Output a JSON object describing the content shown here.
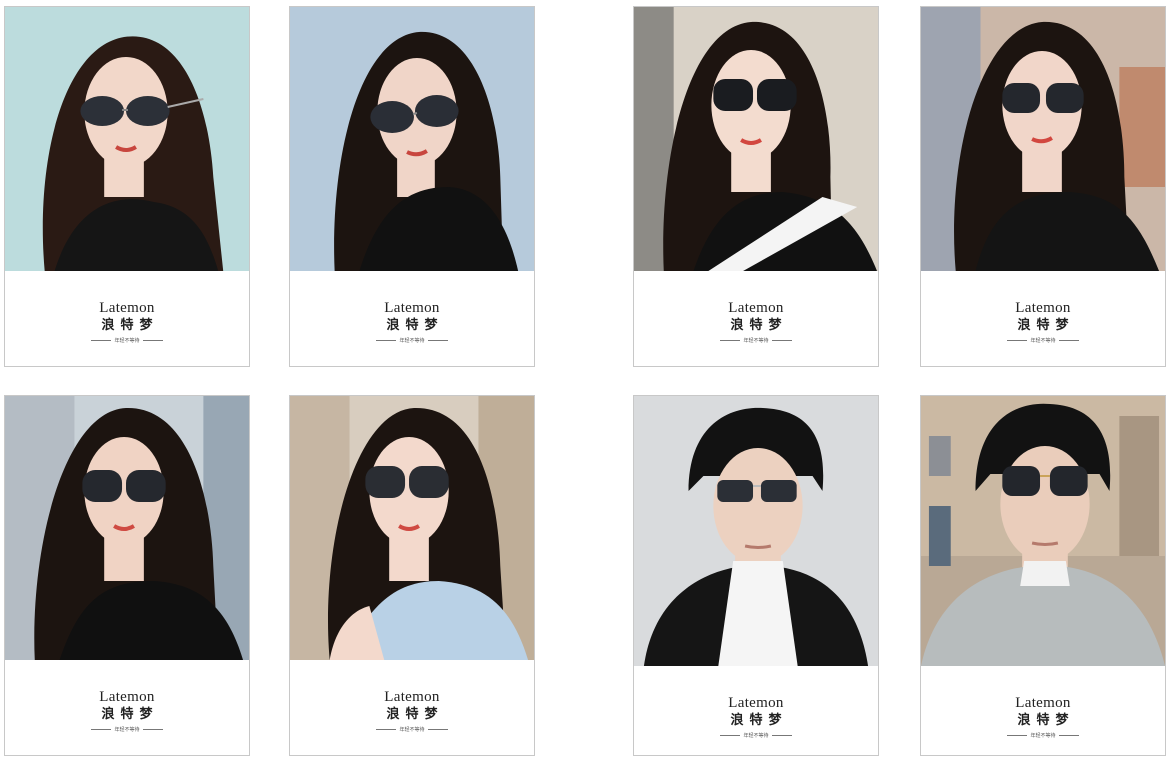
{
  "brand": {
    "name_en": "Latemon",
    "name_cn": "浪特梦",
    "slogan": "年轻不等待"
  },
  "posters": [
    {
      "id": "p1",
      "subject": "woman",
      "bg": "#bcdcdd",
      "hair": "#2a1a14",
      "top": "#151515",
      "skin": "#f2d7c9"
    },
    {
      "id": "p2",
      "subject": "woman",
      "bg": "#b6cadb",
      "hair": "#1c1410",
      "top": "#111111",
      "skin": "#f0d5c8"
    },
    {
      "id": "p3",
      "subject": "woman",
      "bg": "#d9d2c7",
      "hair": "#1d1410",
      "top": "#111111",
      "skin": "#f3dccf"
    },
    {
      "id": "p4",
      "subject": "woman",
      "bg": "#cbb7a8",
      "hair": "#1c1410",
      "top": "#141414",
      "skin": "#f1d6c9"
    },
    {
      "id": "p5",
      "subject": "woman",
      "bg": "#c9d2d8",
      "hair": "#1c1410",
      "top": "#101010",
      "skin": "#f0d3c4"
    },
    {
      "id": "p6",
      "subject": "woman",
      "bg": "#d8cdbf",
      "hair": "#1c1410",
      "top": "#b9d1e6",
      "skin": "#f3d9cc"
    },
    {
      "id": "p7",
      "subject": "man",
      "bg": "#d9dbdd",
      "hair": "#121212",
      "top": "#151515",
      "skin": "#ecd1c0"
    },
    {
      "id": "p8",
      "subject": "man",
      "bg": "#b9a895",
      "hair": "#121212",
      "top": "#b7bcbd",
      "skin": "#eacdbb"
    }
  ]
}
